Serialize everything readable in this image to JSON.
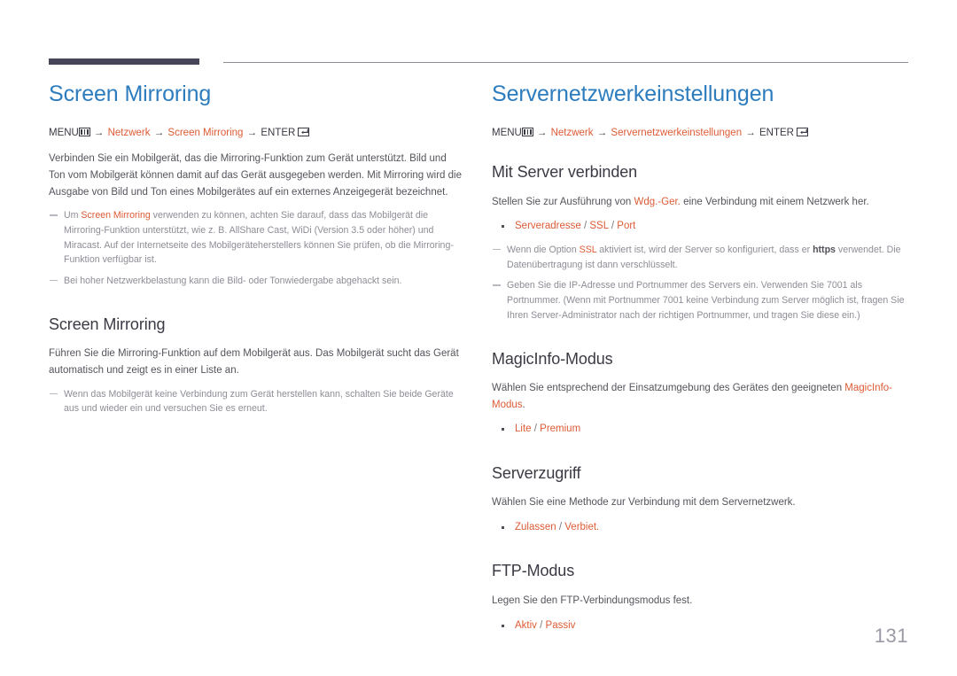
{
  "page": {
    "number": "131",
    "accent_color": "#dd5b36",
    "heading_color": "#2d7cbd",
    "rule_color": "#474659"
  },
  "left_column": {
    "title": "Screen Mirroring",
    "menu_path": {
      "menu_label": "MENU",
      "arrow": "→",
      "step1": "Netzwerk",
      "step2": "Screen Mirroring",
      "enter_label": "ENTER"
    },
    "intro": "Verbinden Sie ein Mobilgerät, das die Mirroring-Funktion zum Gerät unterstützt. Bild und Ton vom Mobilgerät können damit auf das Gerät ausgegeben werden. Mit Mirroring wird die Ausgabe von Bild und Ton eines Mobilgerätes auf ein externes Anzeigegerät bezeichnet.",
    "note1_pre": "Um ",
    "note1_accent": "Screen Mirroring",
    "note1_post": " verwenden zu können, achten Sie darauf, dass das Mobilgerät die Mirroring-Funktion unterstützt, wie z. B. AllShare Cast, WiDi (Version 3.5 oder höher) und Miracast. Auf der Internetseite des Mobilgeräteherstellers können Sie prüfen, ob die Mirroring-Funktion verfügbar ist.",
    "note2": "Bei hoher Netzwerkbelastung kann die Bild- oder Tonwiedergabe abgehackt sein.",
    "section": {
      "heading": "Screen Mirroring",
      "body": "Führen Sie die Mirroring-Funktion auf dem Mobilgerät aus. Das Mobilgerät sucht das Gerät automatisch und zeigt es in einer Liste an.",
      "note": "Wenn das Mobilgerät keine Verbindung zum Gerät herstellen kann, schalten Sie beide Geräte aus und wieder ein und versuchen Sie es erneut."
    }
  },
  "right_column": {
    "title": "Servernetzwerkeinstellungen",
    "menu_path": {
      "menu_label": "MENU",
      "arrow": "→",
      "step1": "Netzwerk",
      "step2": "Servernetzwerkeinstellungen",
      "enter_label": "ENTER"
    },
    "sections": [
      {
        "heading": "Mit Server verbinden",
        "body_pre": "Stellen Sie zur Ausführung von ",
        "body_accent": "Wdg.-Ger.",
        "body_post": " eine Verbindung mit einem Netzwerk her.",
        "bullet": "Serveradresse / SSL / Port",
        "note1_pre": "Wenn die Option ",
        "note1_accent": "SSL",
        "note1_mid": " aktiviert ist, wird der Server so konfiguriert, dass er ",
        "note1_bold": "https",
        "note1_post": " verwendet. Die Datenübertragung ist dann verschlüsselt.",
        "note2": "Geben Sie die IP-Adresse und Portnummer des Servers ein. Verwenden Sie 7001 als Portnummer. (Wenn mit Portnummer 7001 keine Verbindung zum Server möglich ist, fragen Sie Ihren Server-Administrator nach der richtigen Portnummer, und tragen Sie diese ein.)"
      },
      {
        "heading": "MagicInfo-Modus",
        "body_pre": "Wählen Sie entsprechend der Einsatzumgebung des Gerätes den geeigneten ",
        "body_accent": "MagicInfo-Modus",
        "body_post": ".",
        "bullet": "Lite / Premium"
      },
      {
        "heading": "Serverzugriff",
        "body": "Wählen Sie eine Methode zur Verbindung mit dem Servernetzwerk.",
        "bullet": "Zulassen / Verbiet."
      },
      {
        "heading": "FTP-Modus",
        "body": "Legen Sie den FTP-Verbindungsmodus fest.",
        "bullet": "Aktiv / Passiv"
      }
    ]
  }
}
